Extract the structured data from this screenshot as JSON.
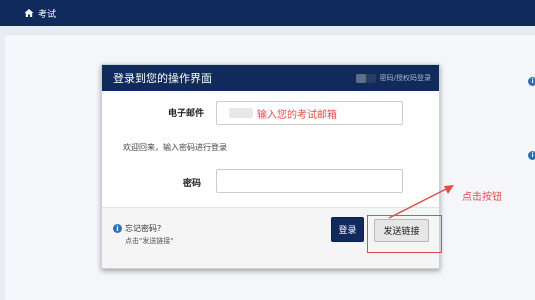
{
  "nav": {
    "home_label": "考试",
    "home_icon": "home-icon"
  },
  "panel": {
    "title": "登录到您的操作界面",
    "toggle_label": "密码/授权码登录",
    "email_label": "电子邮件",
    "email_placeholder": "输入您的考试邮箱",
    "welcome": "欢迎回来，输入密码进行登录",
    "password_label": "密码",
    "password_value": "",
    "forgot": "忘记密码?",
    "forgot_hint": "点击\"发送链接\"",
    "login_button": "登录",
    "send_link_button": "发送链接"
  },
  "annotation": {
    "text": "点击按钮"
  },
  "side_icons": [
    "info-icon",
    "info-icon"
  ],
  "colors": {
    "navy": "#0f2a5b",
    "annotation_red": "#e34b4b",
    "info_blue": "#2f6fb7"
  }
}
